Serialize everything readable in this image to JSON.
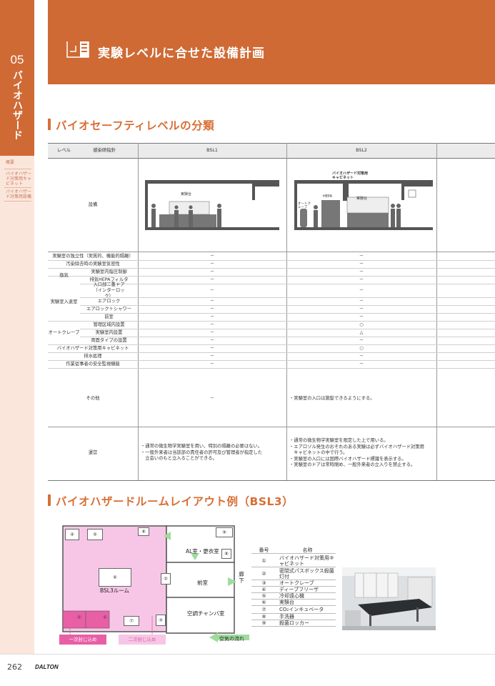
{
  "sidebar": {
    "chapter_number": "05",
    "chapter_title": "バイオハザード",
    "nav": [
      {
        "label": "概要"
      },
      {
        "label": "バイオハザード対策用キャビネット"
      },
      {
        "label": "バイオハザード対策用設備"
      }
    ]
  },
  "header": {
    "title": "実験レベルに合せた設備計画"
  },
  "section1": {
    "title": "バイオセーフティレベルの分類"
  },
  "table": {
    "header": {
      "level": "レベル",
      "guideline": "感染研指針",
      "bsl1": "BSL1",
      "bsl2": "BSL2"
    },
    "equipment_label": "設備",
    "illustrations": {
      "bsl1_bench_label": "実験台",
      "bsl2_cabinet_label": "バイオハザード対策用キャビネット",
      "bsl2_hepa_label": "HEPA",
      "bsl2_bench_label": "実験台",
      "bsl2_autoclave_label": "オートクレーブ"
    },
    "rows": [
      {
        "group": "",
        "item": "実験室の独立性（実質的、機能的隔離）",
        "bsl1": "－",
        "bsl2": "－"
      },
      {
        "group": "",
        "item": "汚染除去時の実験室気密性",
        "bsl1": "－",
        "bsl2": "－"
      },
      {
        "group": "換気",
        "item": "実験室内陰圧制御",
        "bsl1": "－",
        "bsl2": "－"
      },
      {
        "group": "",
        "item": "排気HEPAフィルタ",
        "bsl1": "－",
        "bsl2": "－"
      },
      {
        "group": "",
        "item": "入口部二重ドア（インターロック）",
        "bsl1": "－",
        "bsl2": "－"
      },
      {
        "group": "実験室入退室",
        "item": "エアロック",
        "bsl1": "－",
        "bsl2": "－"
      },
      {
        "group": "",
        "item": "エアロック＋シャワー",
        "bsl1": "－",
        "bsl2": "－"
      },
      {
        "group": "",
        "item": "前室",
        "bsl1": "－",
        "bsl2": "－"
      },
      {
        "group": "",
        "item": "管理区域内設置",
        "bsl1": "－",
        "bsl2": "○"
      },
      {
        "group": "オートクレーブ",
        "item": "実験室内設置",
        "bsl1": "－",
        "bsl2": "△"
      },
      {
        "group": "",
        "item": "両面タイプの設置",
        "bsl1": "－",
        "bsl2": "－"
      },
      {
        "group": "",
        "item": "バイオハザード対策用キャビネット",
        "bsl1": "－",
        "bsl2": "○"
      },
      {
        "group": "",
        "item": "排水処理",
        "bsl1": "－",
        "bsl2": "－"
      },
      {
        "group": "",
        "item": "作業従事者の安全監視機能",
        "bsl1": "－",
        "bsl2": "－"
      }
    ],
    "other": {
      "label": "その他",
      "bsl1": "－",
      "bsl2": "・実験室の入口は施錠できるようにする。"
    },
    "operation": {
      "label": "運営",
      "bsl1": [
        "・通常の微生物学実験室を用い、特別の隔離の必要はない。",
        "・一般外来者は当該部の責任者の許可及び管理者が指定した",
        "　立会いのもと立入ることができる。"
      ],
      "bsl2": [
        "・通常の微生物学実験室を限定した上で用いる。",
        "・エアロゾル発生のおそれのある実験は必ずバイオハザード対策用",
        "　キャビネットの中で行う。",
        "・実験室の入口には国際バイオハザード標識を表示する。",
        "・実験室のドアは常時閉め、一般外来者の立入りを禁止する。"
      ]
    }
  },
  "section2": {
    "title": "バイオハザードルームレイアウト例（BSL3）"
  },
  "diagram": {
    "bsl3_room": "BSL3ルーム",
    "al_room": "AL室・更衣室",
    "ante_room": "前室",
    "corridor": "廊下",
    "chamber_room": "空調チャンバ室",
    "primary_containment": "一次封じ込め",
    "secondary_containment": "二次封じ込め",
    "airflow": "空気の流れ",
    "markers": [
      "④",
      "⑤",
      "⑧",
      "⑨",
      "⑧",
      "⑥",
      "②",
      "①",
      "①",
      "⑦",
      "③"
    ]
  },
  "legend": {
    "header_num": "番号",
    "header_name": "名称",
    "items": [
      {
        "num": "①",
        "name": "バイオハザード対策用キャビネット"
      },
      {
        "num": "②",
        "name": "密閉式パスボックス殺菌灯付"
      },
      {
        "num": "③",
        "name": "オートクレーブ"
      },
      {
        "num": "④",
        "name": "ディープフリーザ"
      },
      {
        "num": "⑤",
        "name": "冷却遠心機"
      },
      {
        "num": "⑥",
        "name": "実験台"
      },
      {
        "num": "⑦",
        "name": "CO₂インキュベータ"
      },
      {
        "num": "⑧",
        "name": "手洗器"
      },
      {
        "num": "⑨",
        "name": "殺菌ロッカー"
      }
    ]
  },
  "footer": {
    "page_number": "262",
    "brand": "DALTON"
  }
}
